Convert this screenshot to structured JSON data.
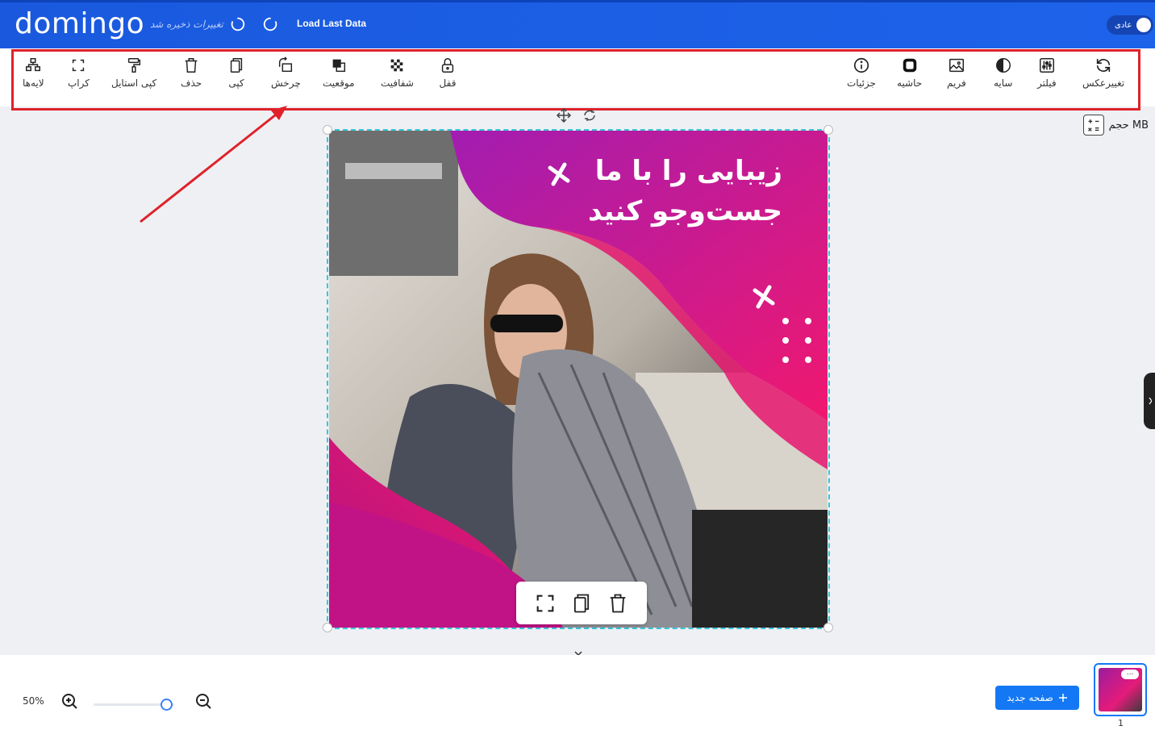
{
  "header": {
    "logo": "domingo",
    "saved_status": "تغییرات ذخیره شد",
    "load_last": "Load Last Data",
    "mode_label": "عادی"
  },
  "toolbar": {
    "left_tools": [
      {
        "label": "لایه‌ها",
        "icon": "layers-icon"
      },
      {
        "label": "کراپ",
        "icon": "crop-icon"
      },
      {
        "label": "کپی استایل",
        "icon": "paint-roller-icon"
      },
      {
        "label": "حذف",
        "icon": "trash-icon"
      },
      {
        "label": "کپی",
        "icon": "copy-icon"
      },
      {
        "label": "چرخش",
        "icon": "rotate-icon"
      },
      {
        "label": "موقعیت",
        "icon": "position-icon"
      },
      {
        "label": "شفافیت",
        "icon": "transparency-icon"
      },
      {
        "label": "قفل",
        "icon": "lock-icon"
      }
    ],
    "right_tools": [
      {
        "label": "جزئیات",
        "icon": "info-icon"
      },
      {
        "label": "حاشیه",
        "icon": "border-icon"
      },
      {
        "label": "فریم",
        "icon": "image-frame-icon"
      },
      {
        "label": "سایه",
        "icon": "shadow-icon"
      },
      {
        "label": "فیلتر",
        "icon": "filter-sliders-icon"
      },
      {
        "label": "تغییرعکس",
        "icon": "refresh-icon"
      }
    ]
  },
  "canvas": {
    "size_label": "حجم MB",
    "design_title_line1": "زیبایی را با ما",
    "design_title_line2": "جست‌وجو کنید"
  },
  "footer": {
    "zoom": "50%",
    "zoom_level": 0.9,
    "new_page": "صفحه جدید",
    "page_number": "1",
    "thumb_menu": "..."
  },
  "colors": {
    "header_blue": "#1d63ea",
    "highlight_red": "#e0212a",
    "selection_cyan": "#37c6d8",
    "design_magenta": "#c4159a",
    "design_pink": "#f0186f",
    "button_blue": "#1478f5"
  }
}
